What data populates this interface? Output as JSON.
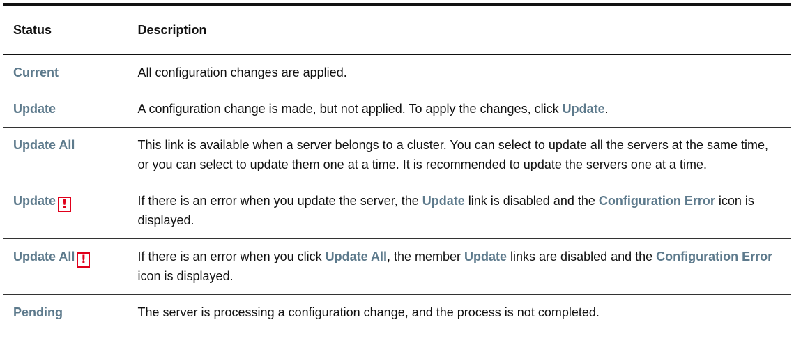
{
  "table": {
    "headers": {
      "status": "Status",
      "description": "Description"
    },
    "rows": [
      {
        "status": "Current",
        "desc": [
          "All configuration changes are applied."
        ]
      },
      {
        "status": "Update",
        "desc": [
          "A configuration change is made, but not applied. To apply the changes, click ",
          "Update",
          "."
        ]
      },
      {
        "status": "Update All",
        "desc": [
          "This link is available when a server belongs to a cluster. You can select to update all the servers at the same time, or you can select to update them one at a time. It is recommended to update the servers one at a time."
        ]
      },
      {
        "status": "Update",
        "status_icon": "!",
        "desc": [
          "If there is an error when you update the server, the ",
          "Update",
          " link is disabled and the ",
          "Configuration Error",
          " icon is displayed."
        ]
      },
      {
        "status": "Update All",
        "status_icon": "!",
        "desc": [
          "If there is an error when you click ",
          "Update All",
          ", the member ",
          "Update",
          " links are disabled and the ",
          "Configuration Error",
          " icon is displayed."
        ]
      },
      {
        "status": "Pending",
        "desc": [
          "The server is processing a configuration change, and the process is not completed."
        ]
      }
    ]
  },
  "colors": {
    "link": "#5d7a8c",
    "error": "#e0001b",
    "text": "#111111"
  },
  "icons": {
    "configuration_error": "exclamation-box-icon"
  }
}
